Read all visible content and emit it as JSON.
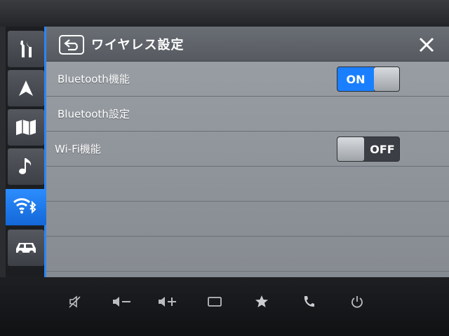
{
  "header": {
    "title": "ワイヤレス設定"
  },
  "settings": [
    {
      "label": "Bluetooth機能",
      "toggle": "ON"
    },
    {
      "label": "Bluetooth設定"
    },
    {
      "label": "Wi-Fi機能",
      "toggle": "OFF"
    }
  ],
  "sidebar": {
    "items": [
      {
        "icon": "tools-icon"
      },
      {
        "icon": "navigation-arrow-icon"
      },
      {
        "icon": "map-icon"
      },
      {
        "icon": "music-note-icon"
      },
      {
        "icon": "wifi-bluetooth-icon",
        "active": true
      },
      {
        "icon": "car-icon"
      }
    ]
  },
  "hardware_buttons": [
    {
      "icon": "mute-icon"
    },
    {
      "icon": "volume-down-icon"
    },
    {
      "icon": "volume-up-icon"
    },
    {
      "icon": "screen-icon"
    },
    {
      "icon": "star-icon"
    },
    {
      "icon": "phone-icon"
    },
    {
      "icon": "power-icon"
    }
  ],
  "colors": {
    "accent": "#1a7fff",
    "panel": "#8f949a",
    "nav_bg": "#1c1e22"
  }
}
